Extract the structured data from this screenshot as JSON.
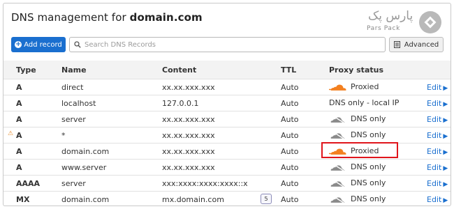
{
  "header": {
    "title_prefix": "DNS management for ",
    "domain": "domain.com"
  },
  "brand": {
    "name_fa": "پارس پک",
    "name_en": "Pars Pack"
  },
  "toolbar": {
    "add_label": "Add record",
    "search_placeholder": "Search DNS Records",
    "advanced_label": "Advanced"
  },
  "columns": {
    "type": "Type",
    "name": "Name",
    "content": "Content",
    "ttl": "TTL",
    "proxy": "Proxy status"
  },
  "rows": [
    {
      "type": "A",
      "name": "direct",
      "content": "xx.xx.xxx.xxx",
      "ttl": "Auto",
      "proxy": "Proxied",
      "edit": "Edit"
    },
    {
      "type": "A",
      "name": "localhost",
      "content": "127.0.0.1",
      "ttl": "Auto",
      "proxy": "DNS only - local IP",
      "edit": "Edit"
    },
    {
      "type": "A",
      "name": "server",
      "content": "xx.xx.xxx.xxx",
      "ttl": "Auto",
      "proxy": "DNS only",
      "edit": "Edit"
    },
    {
      "type": "A",
      "name": "*",
      "content": "xx.xx.xxx.xxx",
      "ttl": "Auto",
      "proxy": "DNS only",
      "edit": "Edit",
      "warning_icon": "warning-icon"
    },
    {
      "type": "A",
      "name": "domain.com",
      "content": "xx.xx.xxx.xxx",
      "ttl": "Auto",
      "proxy": "Proxied",
      "edit": "Edit"
    },
    {
      "type": "A",
      "name": "www.server",
      "content": "xx.xx.xxx.xxx",
      "ttl": "Auto",
      "proxy": "DNS only",
      "edit": "Edit"
    },
    {
      "type": "AAAA",
      "name": "server",
      "content": "xxx:xxxx:xxxx:xxxx::x",
      "ttl": "Auto",
      "proxy": "DNS only",
      "edit": "Edit"
    },
    {
      "type": "MX",
      "name": "domain.com",
      "content": "mx.domain.com",
      "priority": "5",
      "ttl": "Auto",
      "proxy": "DNS only",
      "edit": "Edit"
    }
  ],
  "colors": {
    "accent": "#1a6fcf",
    "proxied_cloud": "#f38020",
    "dns_only_cloud": "#8a8a8a",
    "highlight": "#e0141b"
  }
}
